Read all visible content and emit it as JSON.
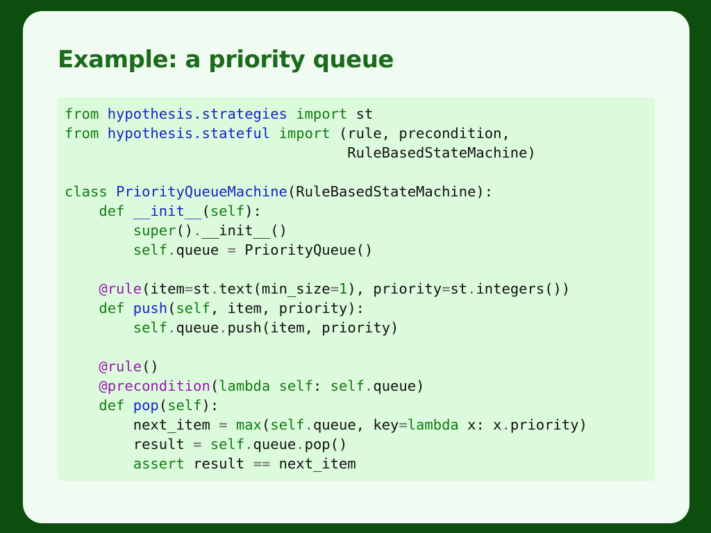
{
  "slide": {
    "title": "Example: a priority queue"
  },
  "code": {
    "lines": [
      [
        {
          "t": "from",
          "c": "kw"
        },
        {
          "t": " ",
          "c": ""
        },
        {
          "t": "hypothesis.strategies",
          "c": "nm"
        },
        {
          "t": " ",
          "c": ""
        },
        {
          "t": "import",
          "c": "kw"
        },
        {
          "t": " st",
          "c": ""
        }
      ],
      [
        {
          "t": "from",
          "c": "kw"
        },
        {
          "t": " ",
          "c": ""
        },
        {
          "t": "hypothesis.stateful",
          "c": "nm"
        },
        {
          "t": " ",
          "c": ""
        },
        {
          "t": "import",
          "c": "kw"
        },
        {
          "t": " (rule, precondition,",
          "c": ""
        }
      ],
      [
        {
          "t": "                                 RuleBasedStateMachine)",
          "c": ""
        }
      ],
      [],
      [
        {
          "t": "class",
          "c": "kw"
        },
        {
          "t": " ",
          "c": ""
        },
        {
          "t": "PriorityQueueMachine",
          "c": "nm"
        },
        {
          "t": "(RuleBasedStateMachine):",
          "c": ""
        }
      ],
      [
        {
          "t": "    ",
          "c": ""
        },
        {
          "t": "def",
          "c": "kw"
        },
        {
          "t": " ",
          "c": ""
        },
        {
          "t": "__init__",
          "c": "nm"
        },
        {
          "t": "(",
          "c": ""
        },
        {
          "t": "self",
          "c": "kw"
        },
        {
          "t": "):",
          "c": ""
        }
      ],
      [
        {
          "t": "        ",
          "c": ""
        },
        {
          "t": "super",
          "c": "kw"
        },
        {
          "t": "()",
          "c": ""
        },
        {
          "t": ".",
          "c": "op"
        },
        {
          "t": "__init__()",
          "c": ""
        }
      ],
      [
        {
          "t": "        ",
          "c": ""
        },
        {
          "t": "self",
          "c": "kw"
        },
        {
          "t": ".",
          "c": "op"
        },
        {
          "t": "queue ",
          "c": ""
        },
        {
          "t": "=",
          "c": "op"
        },
        {
          "t": " PriorityQueue()",
          "c": ""
        }
      ],
      [],
      [
        {
          "t": "    ",
          "c": ""
        },
        {
          "t": "@rule",
          "c": "dec"
        },
        {
          "t": "(item",
          "c": ""
        },
        {
          "t": "=",
          "c": "op"
        },
        {
          "t": "st",
          "c": ""
        },
        {
          "t": ".",
          "c": "op"
        },
        {
          "t": "text(min_size",
          "c": ""
        },
        {
          "t": "=",
          "c": "op"
        },
        {
          "t": "1",
          "c": "num"
        },
        {
          "t": "), priority",
          "c": ""
        },
        {
          "t": "=",
          "c": "op"
        },
        {
          "t": "st",
          "c": ""
        },
        {
          "t": ".",
          "c": "op"
        },
        {
          "t": "integers())",
          "c": ""
        }
      ],
      [
        {
          "t": "    ",
          "c": ""
        },
        {
          "t": "def",
          "c": "kw"
        },
        {
          "t": " ",
          "c": ""
        },
        {
          "t": "push",
          "c": "nm"
        },
        {
          "t": "(",
          "c": ""
        },
        {
          "t": "self",
          "c": "kw"
        },
        {
          "t": ", item, priority):",
          "c": ""
        }
      ],
      [
        {
          "t": "        ",
          "c": ""
        },
        {
          "t": "self",
          "c": "kw"
        },
        {
          "t": ".",
          "c": "op"
        },
        {
          "t": "queue",
          "c": ""
        },
        {
          "t": ".",
          "c": "op"
        },
        {
          "t": "push(item, priority)",
          "c": ""
        }
      ],
      [],
      [
        {
          "t": "    ",
          "c": ""
        },
        {
          "t": "@rule",
          "c": "dec"
        },
        {
          "t": "()",
          "c": ""
        }
      ],
      [
        {
          "t": "    ",
          "c": ""
        },
        {
          "t": "@precondition",
          "c": "dec"
        },
        {
          "t": "(",
          "c": ""
        },
        {
          "t": "lambda",
          "c": "kw"
        },
        {
          "t": " ",
          "c": ""
        },
        {
          "t": "self",
          "c": "kw"
        },
        {
          "t": ": ",
          "c": ""
        },
        {
          "t": "self",
          "c": "kw"
        },
        {
          "t": ".",
          "c": "op"
        },
        {
          "t": "queue)",
          "c": ""
        }
      ],
      [
        {
          "t": "    ",
          "c": ""
        },
        {
          "t": "def",
          "c": "kw"
        },
        {
          "t": " ",
          "c": ""
        },
        {
          "t": "pop",
          "c": "nm"
        },
        {
          "t": "(",
          "c": ""
        },
        {
          "t": "self",
          "c": "kw"
        },
        {
          "t": "):",
          "c": ""
        }
      ],
      [
        {
          "t": "        next_item ",
          "c": ""
        },
        {
          "t": "=",
          "c": "op"
        },
        {
          "t": " ",
          "c": ""
        },
        {
          "t": "max",
          "c": "kw"
        },
        {
          "t": "(",
          "c": ""
        },
        {
          "t": "self",
          "c": "kw"
        },
        {
          "t": ".",
          "c": "op"
        },
        {
          "t": "queue, key",
          "c": ""
        },
        {
          "t": "=",
          "c": "op"
        },
        {
          "t": "lambda",
          "c": "kw"
        },
        {
          "t": " x: x",
          "c": ""
        },
        {
          "t": ".",
          "c": "op"
        },
        {
          "t": "priority)",
          "c": ""
        }
      ],
      [
        {
          "t": "        result ",
          "c": ""
        },
        {
          "t": "=",
          "c": "op"
        },
        {
          "t": " ",
          "c": ""
        },
        {
          "t": "self",
          "c": "kw"
        },
        {
          "t": ".",
          "c": "op"
        },
        {
          "t": "queue",
          "c": ""
        },
        {
          "t": ".",
          "c": "op"
        },
        {
          "t": "pop()",
          "c": ""
        }
      ],
      [
        {
          "t": "        ",
          "c": ""
        },
        {
          "t": "assert",
          "c": "kw"
        },
        {
          "t": " result ",
          "c": ""
        },
        {
          "t": "==",
          "c": "op"
        },
        {
          "t": " next_item",
          "c": ""
        }
      ]
    ]
  }
}
